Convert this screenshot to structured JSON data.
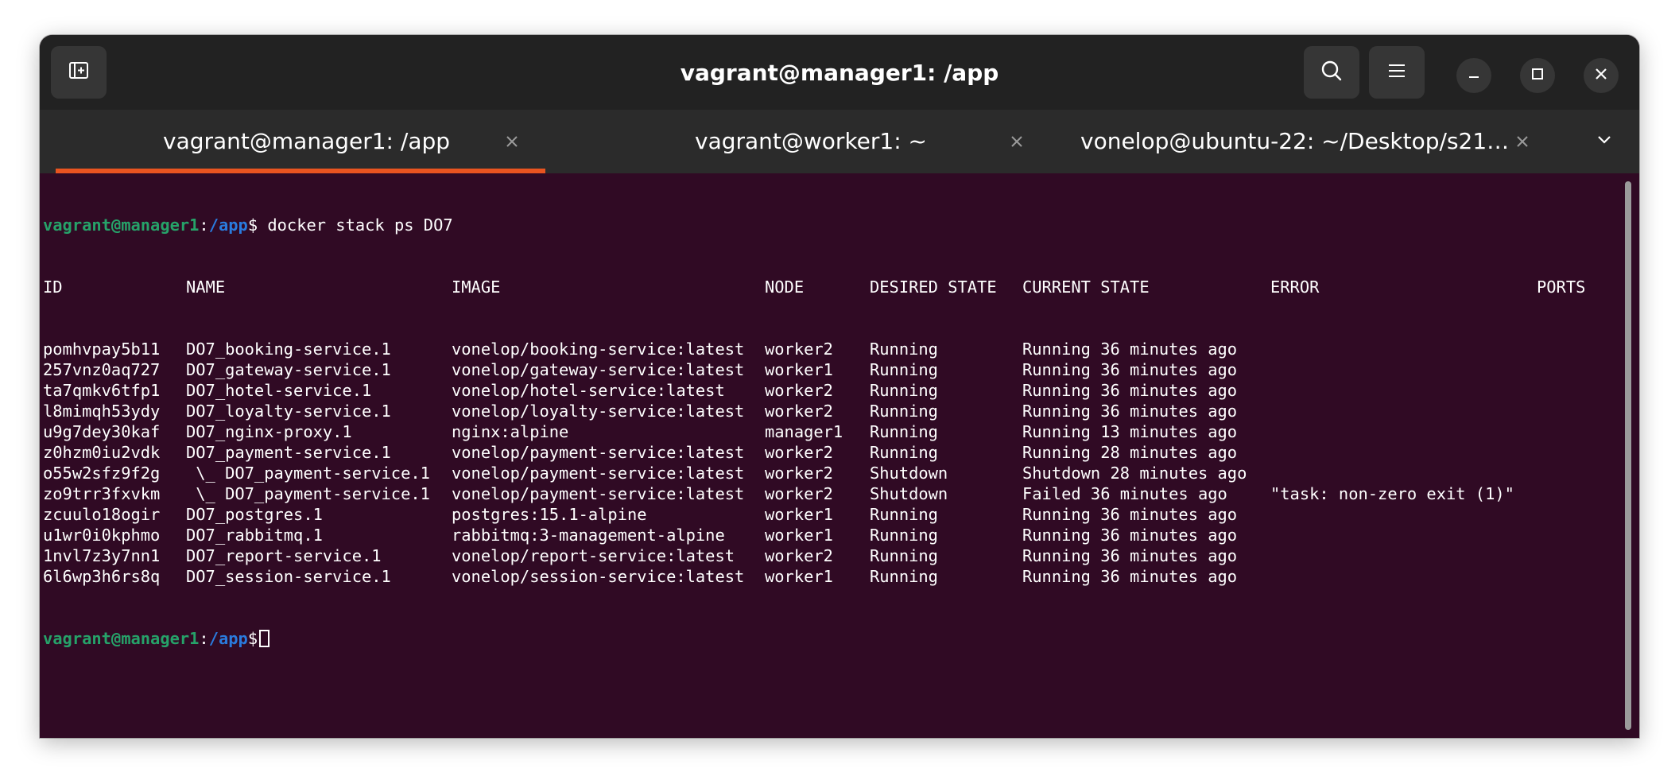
{
  "window": {
    "title": "vagrant@manager1: /app",
    "new_tab_icon": "new-tab-icon",
    "search_icon": "search-icon",
    "menu_icon": "hamburger-menu-icon",
    "minimize_icon": "minimize-icon",
    "maximize_icon": "maximize-icon",
    "close_icon": "close-icon"
  },
  "tabs": [
    {
      "label": "vagrant@manager1: /app",
      "active": true
    },
    {
      "label": "vagrant@worker1: ~",
      "active": false
    },
    {
      "label": "vonelop@ubuntu-22: ~/Desktop/s21…",
      "active": false
    }
  ],
  "terminal": {
    "prompt_user": "vagrant@manager1",
    "prompt_sep": ":",
    "prompt_path": "/app",
    "prompt_dollar": "$",
    "command": " docker stack ps DO7",
    "headers": [
      "ID",
      "NAME",
      "IMAGE",
      "NODE",
      "DESIRED STATE",
      "CURRENT STATE",
      "ERROR",
      "PORTS"
    ],
    "rows": [
      [
        "pomhvpay5b11",
        "DO7_booking-service.1",
        "vonelop/booking-service:latest",
        "worker2",
        "Running",
        "Running 36 minutes ago",
        "",
        ""
      ],
      [
        "257vnz0aq727",
        "DO7_gateway-service.1",
        "vonelop/gateway-service:latest",
        "worker1",
        "Running",
        "Running 36 minutes ago",
        "",
        ""
      ],
      [
        "ta7qmkv6tfp1",
        "DO7_hotel-service.1",
        "vonelop/hotel-service:latest",
        "worker2",
        "Running",
        "Running 36 minutes ago",
        "",
        ""
      ],
      [
        "l8mimqh53ydy",
        "DO7_loyalty-service.1",
        "vonelop/loyalty-service:latest",
        "worker2",
        "Running",
        "Running 36 minutes ago",
        "",
        ""
      ],
      [
        "u9g7dey30kaf",
        "DO7_nginx-proxy.1",
        "nginx:alpine",
        "manager1",
        "Running",
        "Running 13 minutes ago",
        "",
        ""
      ],
      [
        "z0hzm0iu2vdk",
        "DO7_payment-service.1",
        "vonelop/payment-service:latest",
        "worker2",
        "Running",
        "Running 28 minutes ago",
        "",
        ""
      ],
      [
        "o55w2sfz9f2g",
        " \\_ DO7_payment-service.1",
        "vonelop/payment-service:latest",
        "worker2",
        "Shutdown",
        "Shutdown 28 minutes ago",
        "",
        ""
      ],
      [
        "zo9trr3fxvkm",
        " \\_ DO7_payment-service.1",
        "vonelop/payment-service:latest",
        "worker2",
        "Shutdown",
        "Failed 36 minutes ago",
        "\"task: non-zero exit (1)\"",
        ""
      ],
      [
        "zcuulo18ogir",
        "DO7_postgres.1",
        "postgres:15.1-alpine",
        "worker1",
        "Running",
        "Running 36 minutes ago",
        "",
        ""
      ],
      [
        "u1wr0i0kphmo",
        "DO7_rabbitmq.1",
        "rabbitmq:3-management-alpine",
        "worker1",
        "Running",
        "Running 36 minutes ago",
        "",
        ""
      ],
      [
        "1nvl7z3y7nn1",
        "DO7_report-service.1",
        "vonelop/report-service:latest",
        "worker2",
        "Running",
        "Running 36 minutes ago",
        "",
        ""
      ],
      [
        "6l6wp3h6rs8q",
        "DO7_session-service.1",
        "vonelop/session-service:latest",
        "worker1",
        "Running",
        "Running 36 minutes ago",
        "",
        ""
      ]
    ]
  },
  "colors": {
    "terminal_bg": "#300a24",
    "titlebar_bg": "#222222",
    "tabbar_bg": "#2b2b2b",
    "accent": "#e95420",
    "prompt_user": "#26a269",
    "prompt_path": "#2a7bde"
  }
}
